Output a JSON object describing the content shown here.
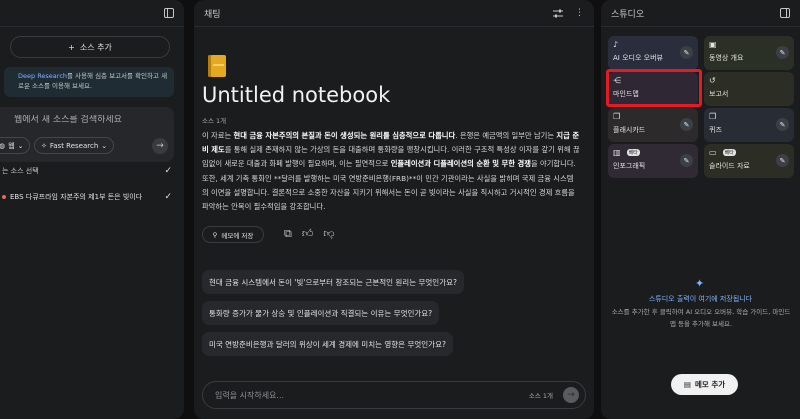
{
  "left": {
    "collapse_icon": "sidebar-collapse-icon",
    "add_source_label": "소스 추가",
    "notice_highlight": "Deep Research",
    "notice_text": "를 사용해 심층 보고서를 확인하고 새로운 소스를 이용해 보세요.",
    "search_placeholder": "웹에서 새 소스를 검색하세요",
    "chip_web_label": "웹",
    "chip_research_label": "Fast Research",
    "select_all_label": "는 소스 선택",
    "source_item_label": "EBS 다큐프라임 자본주의 제1부 돈은 빚이다"
  },
  "middle": {
    "header_title": "채팅",
    "notebook_title": "Untitled notebook",
    "source_count": "소스 1개",
    "summary": {
      "p1": "이 자료는 ",
      "b1": "현대 금융 자본주의의 본질과 돈이 생성되는 원리를 심층적으로 다룹니다",
      "p2": ". 은행은 예금액의 일부만 남기는 ",
      "b2": "지급 준비 제도",
      "p3": "를 통해 실제 존재하지 않는 가상의 돈을 대출하며 통화량을 팽창시킵니다. 이러한 구조적 특성상 이자를 갚기 위해 끊임없이 새로운 대출과 화폐 발행이 필요하며, 이는 필연적으로 ",
      "b3": "인플레이션과 디플레이션의 순환 및 무한 경쟁",
      "p4": "을 야기합니다. 또한, 세계 기축 통화인 **달러를 발행하는 미국 연방준비은행(FRB)**이 민간 기관이라는 사실을 밝히며 국제 금융 시스템의 이면을 설명합니다. 결론적으로 소중한 자산을 지키기 위해서는 돈이 곧 빚이라는 사실을 직시하고 거시적인 경제 흐름을 파악하는 안목이 필수적임을 강조합니다."
    },
    "save_note_label": "메모에 저장",
    "suggestions": [
      "현대 금융 시스템에서 돈이 '빚'으로부터 창조되는 근본적인 원리는 무엇인가요?",
      "통화량 증가가 물가 상승 및 인플레이션과 직결되는 이유는 무엇인가요?",
      "미국 연방준비은행과 달러의 위상이 세계 경제에 미치는 영향은 무엇인가요?"
    ],
    "chat_placeholder": "입력을 시작하세요...",
    "chat_source_count": "소스 1개"
  },
  "right": {
    "header_title": "스튜디오",
    "tiles": [
      {
        "label": "AI 오디오 오버뷰",
        "icon": "audio-icon",
        "beta": ""
      },
      {
        "label": "동영상 개요",
        "icon": "video-icon",
        "beta": ""
      },
      {
        "label": "마인드맵",
        "icon": "mindmap-icon",
        "beta": ""
      },
      {
        "label": "보고서",
        "icon": "report-icon",
        "beta": ""
      },
      {
        "label": "플래시카드",
        "icon": "flashcard-icon",
        "beta": ""
      },
      {
        "label": "퀴즈",
        "icon": "quiz-icon",
        "beta": ""
      },
      {
        "label": "인포그래픽",
        "icon": "infographic-icon",
        "beta": "베타"
      },
      {
        "label": "슬라이드 자료",
        "icon": "slides-icon",
        "beta": "베타"
      }
    ],
    "empty_title": "스튜디오 출력이 여기에 저장됩니다",
    "empty_desc": "소스를 추가한 후 클릭하여 AI 오디오 오버뷰, 학습 가이드, 마인드맵 등을 추가해 보세요.",
    "add_note_label": "메모 추가"
  },
  "colors": {
    "highlight_border": "#e21b24",
    "accent_blue": "#7fb3ff"
  }
}
